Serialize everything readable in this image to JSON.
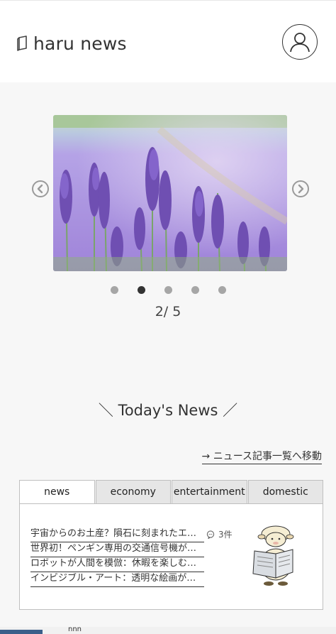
{
  "header": {
    "brand_title": "haru news",
    "brand_icon": "book-icon",
    "account_icon": "user-icon"
  },
  "carousel": {
    "image_subject": "lavender field",
    "current": 2,
    "total": 5,
    "counter_text": "2/ 5",
    "dots": [
      false,
      true,
      false,
      false,
      false
    ]
  },
  "section": {
    "heading": "＼ Today's News ／",
    "all_link": "→ ニュース記事一覧へ移動"
  },
  "tabs": [
    {
      "label": "news",
      "active": true
    },
    {
      "label": "economy",
      "active": false
    },
    {
      "label": "entertainment",
      "active": false
    },
    {
      "label": "domestic",
      "active": false
    }
  ],
  "news": {
    "items": [
      "宇宙からのお土産？隕石に刻まれたエイリアンの",
      "世界初！ペンギン専用の交通信号機が設置される",
      "ロボットが人間を模倣：休暇を楽しむロボット",
      "インビジブル・アート：透明な絵画が展示される"
    ],
    "comment_count": "3件"
  },
  "footer": {
    "fragment_text": "nnn"
  },
  "colors": {
    "background": "#f7f7f7",
    "header": "#ffffff",
    "dot_active": "#333333",
    "dot_inactive": "#a6a6a6",
    "tab_inactive": "#e6e6e6"
  }
}
